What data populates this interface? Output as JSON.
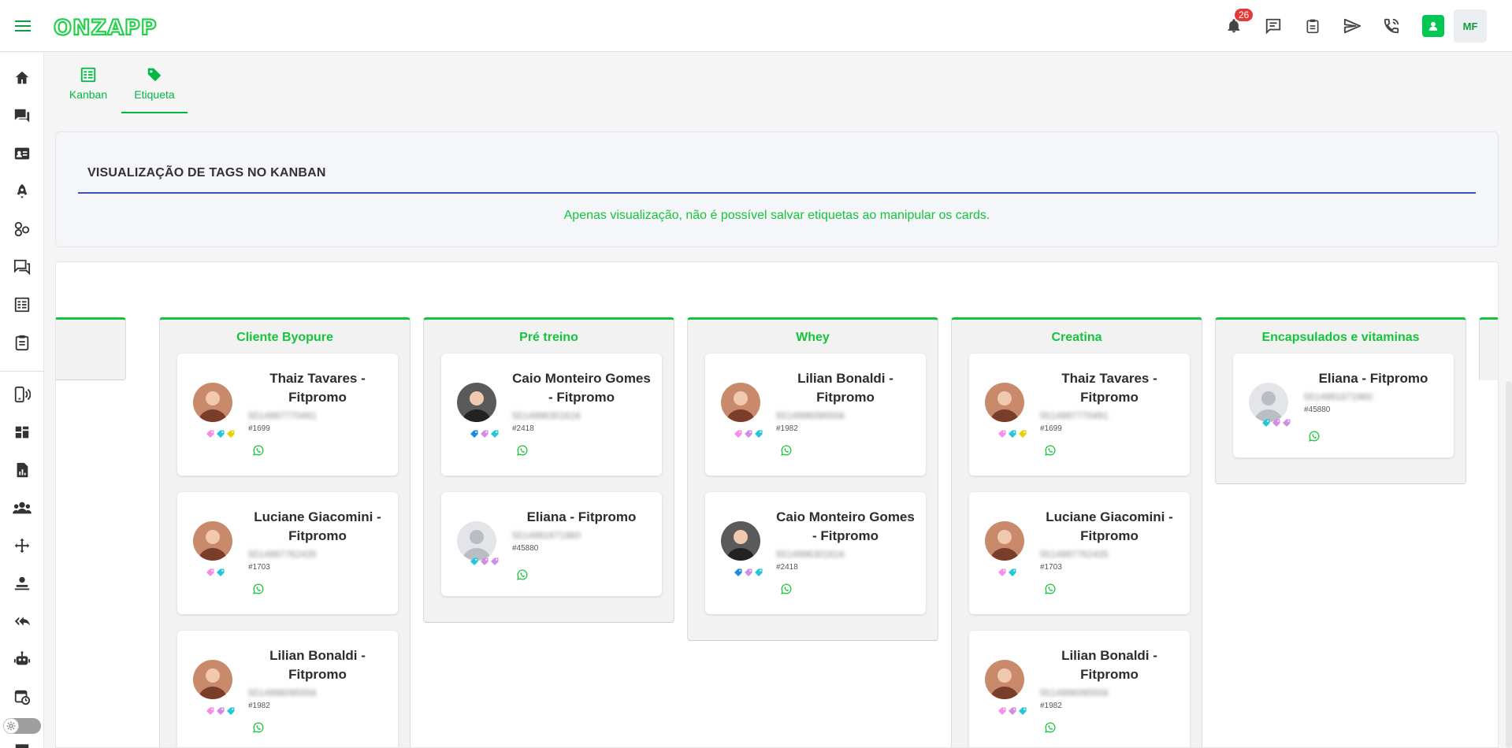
{
  "app": {
    "logo_text": "ONZAPP"
  },
  "header": {
    "notification_count": "26",
    "user_initials": "MF"
  },
  "tabs": [
    {
      "label": "Kanban",
      "icon": "kanban-icon"
    },
    {
      "label": "Etiqueta",
      "icon": "tag-icon"
    }
  ],
  "info": {
    "title": "VISUALIZAÇÃO DE TAGS NO KANBAN",
    "note": "Apenas visualização, não é possível salvar etiquetas ao manipular os cards."
  },
  "columns": [
    {
      "title": "Cliente Byopure",
      "cards": [
        {
          "name": "Thaiz Tavares - Fitpromo",
          "phone": "5514997770491",
          "id": "#1699",
          "tags": [
            "#f48fe6",
            "#26c6da",
            "#e6d200"
          ]
        },
        {
          "name": "Luciane Giacomini - Fitpromo",
          "phone": "5514997762435",
          "id": "#1703",
          "tags": [
            "#f48fe6",
            "#26c6da"
          ]
        },
        {
          "name": "Lilian Bonaldi - Fitpromo",
          "phone": "5514996095556",
          "id": "#1982",
          "tags": [
            "#f48fe6",
            "#d18de3",
            "#26c6da"
          ]
        }
      ]
    },
    {
      "title": "Pré treino",
      "cards": [
        {
          "name": "Caio Monteiro Gomes - Fitpromo",
          "phone": "5514996301616",
          "id": "#2418",
          "tags": [
            "#1e88e5",
            "#d18de3",
            "#26c6da"
          ]
        },
        {
          "name": "Eliana - Fitpromo",
          "phone": "5514991671960",
          "id": "#45880",
          "tags": [
            "#26c6da",
            "#d18de3",
            "#d18de3"
          ]
        }
      ]
    },
    {
      "title": "Whey",
      "cards": [
        {
          "name": "Lilian Bonaldi - Fitpromo",
          "phone": "5514996095556",
          "id": "#1982",
          "tags": [
            "#f48fe6",
            "#d18de3",
            "#26c6da"
          ]
        },
        {
          "name": "Caio Monteiro Gomes - Fitpromo",
          "phone": "5514996301616",
          "id": "#2418",
          "tags": [
            "#1e88e5",
            "#d18de3",
            "#26c6da"
          ]
        }
      ]
    },
    {
      "title": "Creatina",
      "cards": [
        {
          "name": "Thaiz Tavares - Fitpromo",
          "phone": "5514997770491",
          "id": "#1699",
          "tags": [
            "#f48fe6",
            "#26c6da",
            "#e6d200"
          ]
        },
        {
          "name": "Luciane Giacomini - Fitpromo",
          "phone": "5514997762435",
          "id": "#1703",
          "tags": [
            "#f48fe6",
            "#26c6da"
          ]
        },
        {
          "name": "Lilian Bonaldi - Fitpromo",
          "phone": "5514996095556",
          "id": "#1982",
          "tags": [
            "#f48fe6",
            "#d18de3",
            "#26c6da"
          ]
        }
      ]
    },
    {
      "title": "Encapsulados e vitaminas",
      "cards": [
        {
          "name": "Eliana - Fitpromo",
          "phone": "5514991671960",
          "id": "#45880",
          "tags": [
            "#26c6da",
            "#d18de3",
            "#d18de3"
          ]
        }
      ]
    }
  ],
  "colors": {
    "accent": "#16c43a",
    "rule": "#3f51b5",
    "badge": "#e53935"
  }
}
